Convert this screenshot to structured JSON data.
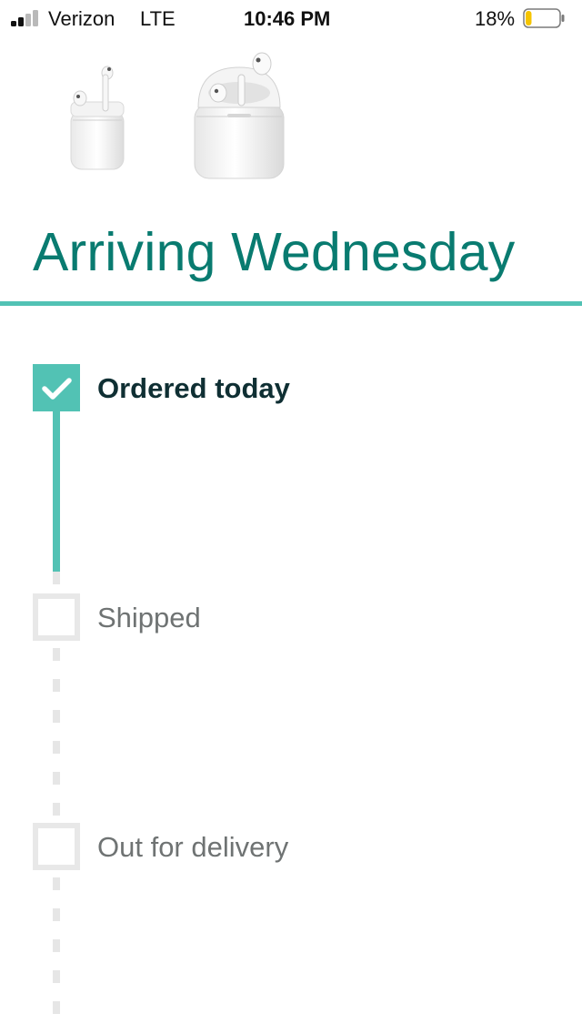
{
  "status_bar": {
    "carrier": "Verizon",
    "network": "LTE",
    "time": "10:46 PM",
    "battery_percent": "18%",
    "battery_level": 0.18,
    "battery_color": "#f5c400"
  },
  "products": [
    {
      "icon": "airpods-open-case-image"
    },
    {
      "icon": "airpods-case-image"
    }
  ],
  "delivery": {
    "heading": "Arriving Wednesday",
    "accent_color": "#52c2b4",
    "heading_color": "#097b70",
    "steps": [
      {
        "label": "Ordered today",
        "completed": true
      },
      {
        "label": "Shipped",
        "completed": false
      },
      {
        "label": "Out for delivery",
        "completed": false
      }
    ]
  }
}
